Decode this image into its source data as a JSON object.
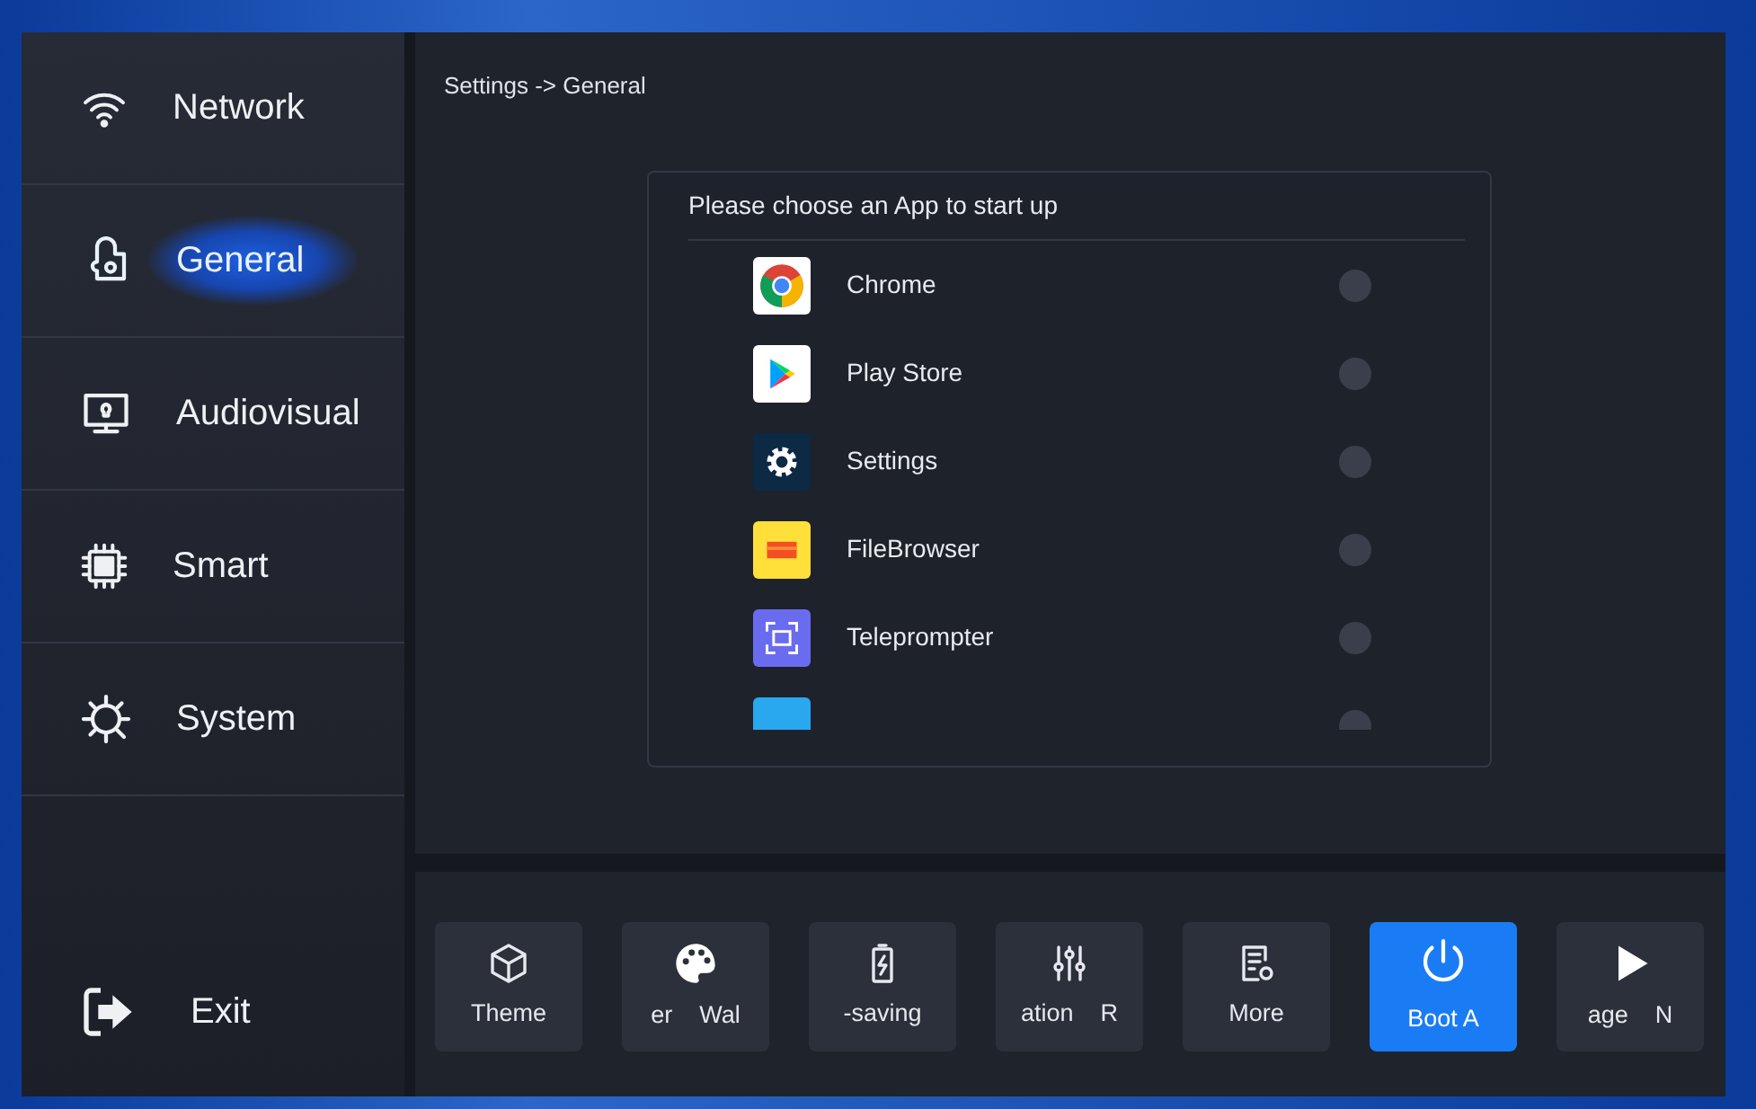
{
  "sidebar": {
    "items": [
      {
        "label": "Network",
        "selected": false
      },
      {
        "label": "General",
        "selected": true
      },
      {
        "label": "Audiovisual",
        "selected": false
      },
      {
        "label": "Smart",
        "selected": false
      },
      {
        "label": "System",
        "selected": false
      }
    ],
    "exit": {
      "label": "Exit"
    }
  },
  "breadcrumb": "Settings -> General",
  "dialog": {
    "title": "Please choose an App to start up",
    "apps": [
      {
        "kind": "app",
        "name": "Chrome",
        "selected": false
      },
      {
        "kind": "app",
        "name": "Play Store",
        "selected": false
      },
      {
        "kind": "app",
        "name": "Settings",
        "selected": false
      },
      {
        "kind": "app",
        "name": "FileBrowser",
        "selected": false
      },
      {
        "kind": "app",
        "name": "Teleprompter",
        "selected": false
      },
      {
        "kind": "partial",
        "selected": false
      }
    ]
  },
  "toolbar": [
    {
      "label": "Theme",
      "selected": false
    },
    {
      "label": "er    Wal",
      "selected": false
    },
    {
      "label": "-saving",
      "selected": false
    },
    {
      "label": "ation    R",
      "selected": false
    },
    {
      "label": "More",
      "selected": false
    },
    {
      "label": "Boot A",
      "selected": true
    },
    {
      "label": "age    N",
      "selected": false
    }
  ]
}
